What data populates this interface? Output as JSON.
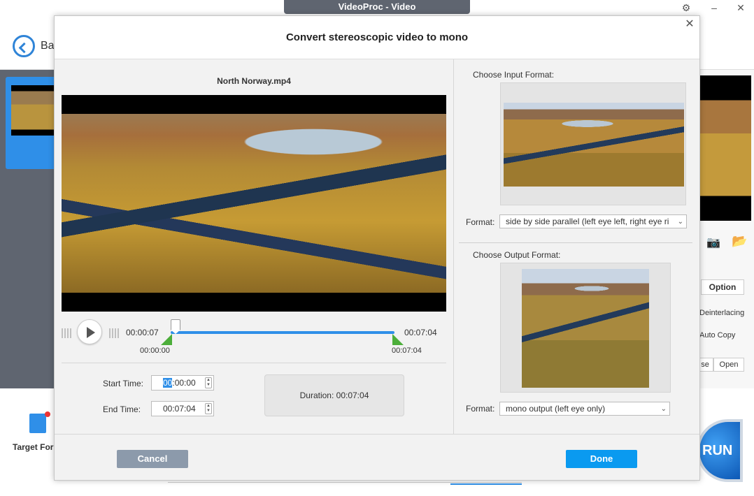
{
  "app": {
    "window_title": "VideoProc - Video",
    "back_label": "Ba",
    "target_label": "Target For",
    "option_label": "Option",
    "deinterlacing_label": "Deinterlacing",
    "auto_copy_label": "Auto Copy",
    "close_partial_label": "se",
    "open_label": "Open",
    "run_label": "RUN"
  },
  "dialog": {
    "title": "Convert stereoscopic video to mono",
    "file_name": "North Norway.mp4",
    "playback": {
      "current_time": "00:00:07",
      "total_time": "00:07:04",
      "start_marker_time": "00:00:00",
      "end_marker_time": "00:07:04"
    },
    "start_time": {
      "label": "Start Time:",
      "value_selected": "00",
      "value_rest": ":00:00"
    },
    "end_time": {
      "label": "End Time:",
      "value": "00:07:04"
    },
    "duration": "Duration:  00:07:04",
    "input": {
      "title": "Choose Input Format:",
      "format_label": "Format:",
      "format_value": "side by side parallel (left eye left, right eye ri"
    },
    "output": {
      "title": "Choose Output Format:",
      "format_label": "Format:",
      "format_value": "mono output (left eye only)"
    },
    "cancel_label": "Cancel",
    "done_label": "Done"
  },
  "colors": {
    "accent": "#0a9af0",
    "cancel_bg": "#8c9aab",
    "marker_green": "#4cae3a",
    "sidebar_dark": "#5f6570"
  }
}
